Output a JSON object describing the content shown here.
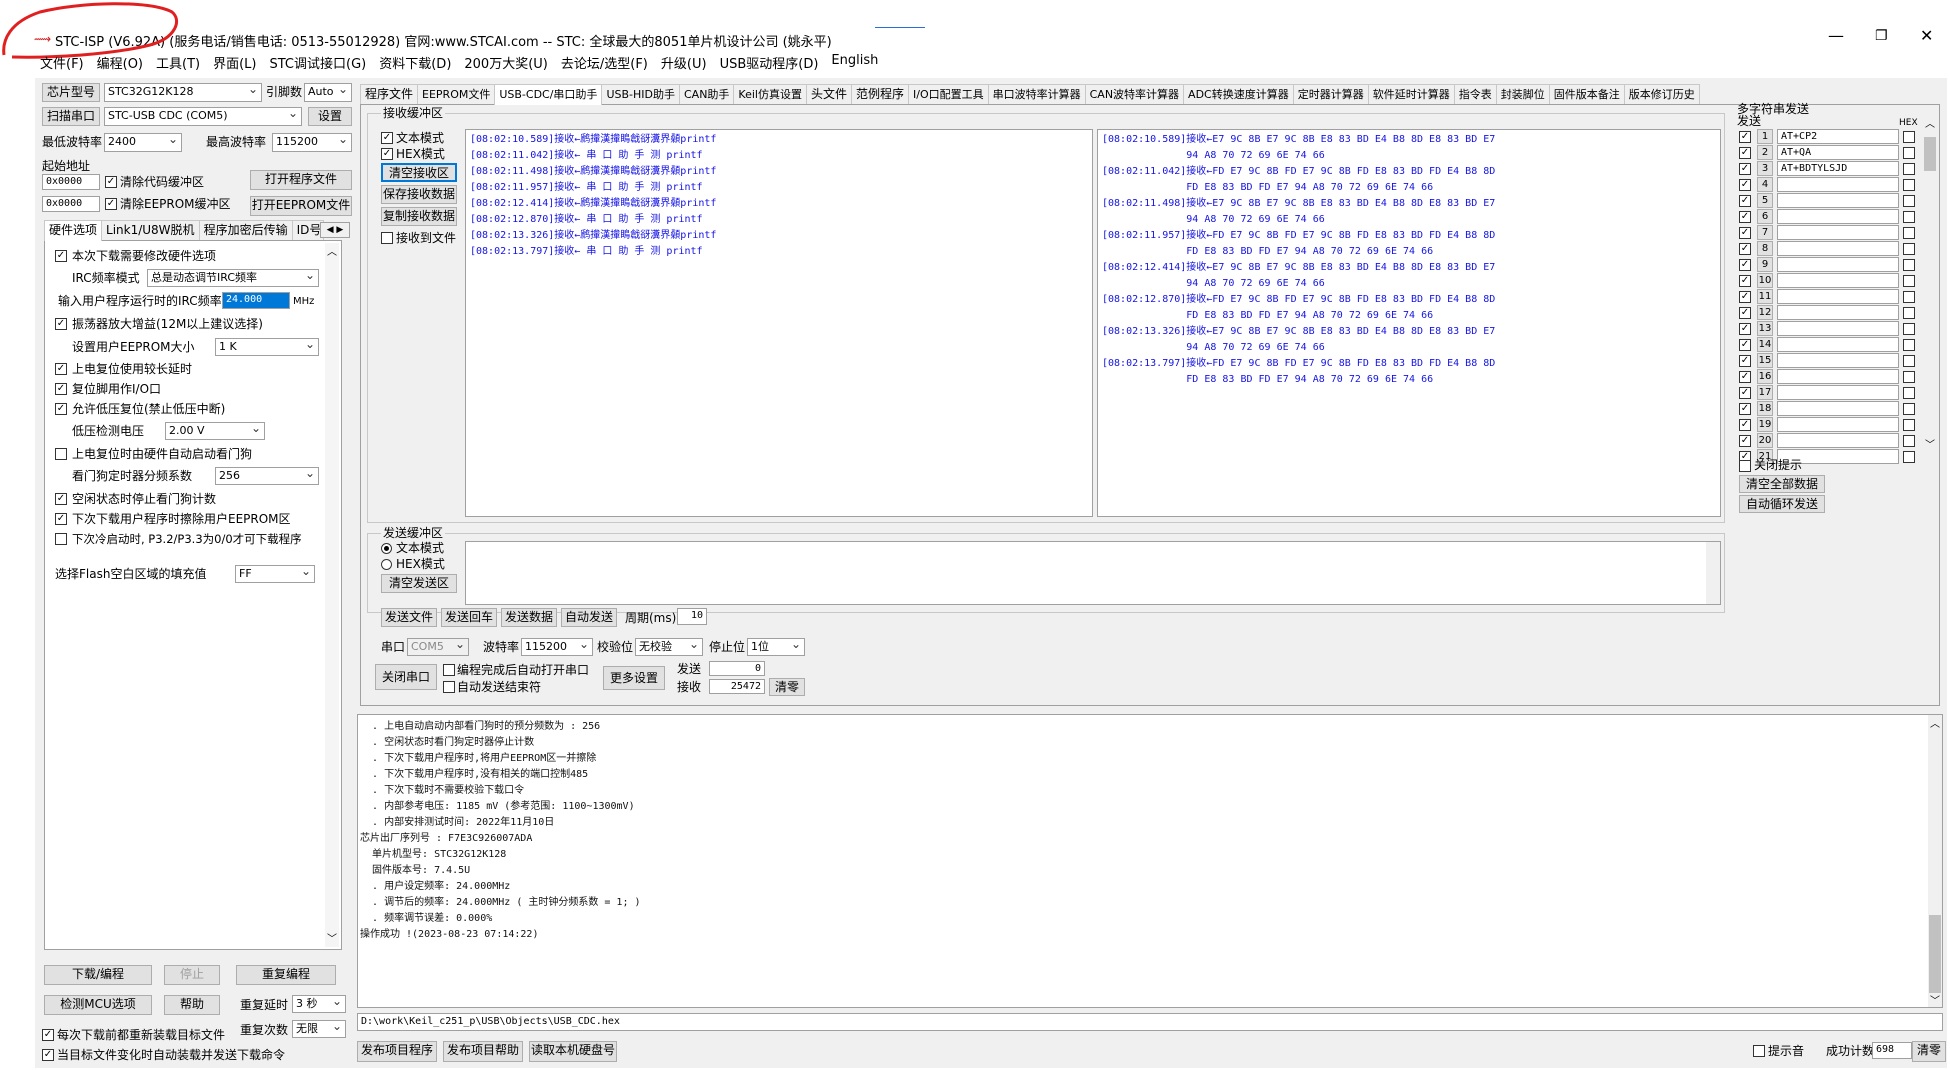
{
  "window": {
    "title": "STC-ISP (V6.92A) (服务电话/销售电话: 0513-55012928) 官网:www.STCAI.com  -- STC: 全球最大的8051单片机设计公司 (姚永平)",
    "annotation_color": "#e02020"
  },
  "menu": [
    "文件(F)",
    "编程(O)",
    "工具(T)",
    "界面(L)",
    "STC调试接口(G)",
    "资料下载(D)",
    "200万大奖(U)",
    "去论坛/选型(F)",
    "升级(U)",
    "USB驱动程序(D)",
    "English"
  ],
  "left": {
    "chip_type_btn": "芯片型号",
    "chip_type": "STC32G12K128",
    "pins_label": "引脚数",
    "pins": "Auto",
    "scan_port_btn": "扫描串口",
    "port": "STC-USB CDC (COM5)",
    "settings_btn": "设置",
    "min_baud_label": "最低波特率",
    "min_baud": "2400",
    "max_baud_label": "最高波特率",
    "max_baud": "115200",
    "start_addr_label": "起始地址",
    "addr1": "0x0000",
    "clear_code_label": "清除代码缓冲区",
    "open_program_btn": "打开程序文件",
    "addr2": "0x0000",
    "clear_eeprom_label": "清除EEPROM缓冲区",
    "open_eeprom_btn": "打开EEPROM文件",
    "tabs": [
      "硬件选项",
      "Link1/U8W脱机",
      "程序加密后传输",
      "ID号"
    ],
    "options": [
      {
        "text": "本次下载需要修改硬件选项",
        "checked": true
      },
      {
        "text": "IRC频率模式",
        "select": "总是动态调节IRC频率"
      },
      {
        "text": "输入用户程序运行时的IRC频率",
        "input": "24.000",
        "unit": "MHz"
      },
      {
        "text": "振荡器放大增益(12M以上建议选择)",
        "checked": true
      },
      {
        "text": "设置用户EEPROM大小",
        "select": "1   K"
      },
      {
        "text": "上电复位使用较长延时",
        "checked": true
      },
      {
        "text": "复位脚用作I/O口",
        "checked": true
      },
      {
        "text": "允许低压复位(禁止低压中断)",
        "checked": true
      },
      {
        "text": "低压检测电压",
        "select": "2.00 V"
      },
      {
        "text": "上电复位时由硬件自动启动看门狗",
        "checked": false
      },
      {
        "text": "看门狗定时器分频系数",
        "select": "256"
      },
      {
        "text": "空闲状态时停止看门狗计数",
        "checked": true
      },
      {
        "text": "下次下载用户程序时擦除用户EEPROM区",
        "checked": true
      },
      {
        "text": "下次冷启动时, P3.2/P3.3为0/0才可下载程序",
        "checked": false
      },
      {
        "text": "选择Flash空白区域的填充值",
        "select": "FF"
      }
    ],
    "download_btn": "下载/编程",
    "stop_btn": "停止",
    "reprogram_btn": "重复编程",
    "detect_btn": "检测MCU选项",
    "help_btn": "帮助",
    "repeat_delay_label": "重复延时",
    "repeat_delay": "3 秒",
    "repeat_count_label": "重复次数",
    "repeat_count": "无限",
    "reload_before_label": "每次下载前都重新装载目标文件",
    "auto_load_label": "当目标文件变化时自动装载并发送下载命令"
  },
  "tabs": [
    "程序文件",
    "EEPROM文件",
    "USB-CDC/串口助手",
    "USB-HID助手",
    "CAN助手",
    "Keil仿真设置",
    "头文件",
    "范例程序",
    "I/O口配置工具",
    "串口波特率计算器",
    "CAN波特率计算器",
    "ADC转换速度计算器",
    "定时器计算器",
    "软件延时计算器",
    "指令表",
    "封装脚位",
    "固件版本备注",
    "版本修订历史"
  ],
  "receive": {
    "group_label": "接收缓冲区",
    "text_mode": "文本模式",
    "hex_mode": "HEX模式",
    "clear_btn": "清空接收区",
    "save_btn": "保存接收数据",
    "copy_btn": "复制接收数据",
    "to_file": "接收到文件",
    "text_lines": [
      "[08:02:10.589]接收←䴘撪漢撪瞗戧谺瀵界顙printf",
      "[08:02:11.042]接收← 串 口 助 手 测 printf",
      "[08:02:11.498]接收←䴘撪漢撪瞗戧谺瀵界顙printf",
      "[08:02:11.957]接收← 串 口 助 手 测 printf",
      "[08:02:12.414]接收←䴘撪漢撪瞗戧谺瀵界顙printf",
      "[08:02:12.870]接收← 串 口 助 手 测 printf",
      "[08:02:13.326]接收←䴘撪漢撪瞗戧谺瀵界顙printf",
      "[08:02:13.797]接收← 串 口 助 手 测 printf"
    ],
    "hex_lines": [
      "[08:02:10.589]接收←E7 9C 8B E7 9C 8B E8 83 BD E4 B8 8D E8 83 BD E7",
      "              94 A8 70 72 69 6E 74 66",
      "[08:02:11.042]接收←FD E7 9C 8B FD E7 9C 8B FD E8 83 BD FD E4 B8 8D",
      "              FD E8 83 BD FD E7 94 A8 70 72 69 6E 74 66",
      "[08:02:11.498]接收←E7 9C 8B E7 9C 8B E8 83 BD E4 B8 8D E8 83 BD E7",
      "              94 A8 70 72 69 6E 74 66",
      "[08:02:11.957]接收←FD E7 9C 8B FD E7 9C 8B FD E8 83 BD FD E4 B8 8D",
      "              FD E8 83 BD FD E7 94 A8 70 72 69 6E 74 66",
      "[08:02:12.414]接收←E7 9C 8B E7 9C 8B E8 83 BD E4 B8 8D E8 83 BD E7",
      "              94 A8 70 72 69 6E 74 66",
      "[08:02:12.870]接收←FD E7 9C 8B FD E7 9C 8B FD E8 83 BD FD E4 B8 8D",
      "              FD E8 83 BD FD E7 94 A8 70 72 69 6E 74 66",
      "[08:02:13.326]接收←E7 9C 8B E7 9C 8B E8 83 BD E4 B8 8D E8 83 BD E7",
      "              94 A8 70 72 69 6E 74 66",
      "[08:02:13.797]接收←FD E7 9C 8B FD E7 9C 8B FD E8 83 BD FD E4 B8 8D",
      "              FD E8 83 BD FD E7 94 A8 70 72 69 6E 74 66"
    ]
  },
  "send": {
    "group_label": "发送缓冲区",
    "text_mode": "文本模式",
    "hex_mode": "HEX模式",
    "clear_btn": "清空发送区",
    "send_file_btn": "发送文件",
    "send_enter_btn": "发送回车",
    "send_data_btn": "发送数据",
    "auto_send_btn": "自动发送",
    "period_label": "周期(ms)",
    "period": "10"
  },
  "port": {
    "port_label": "串口",
    "port": "COM5",
    "baud_label": "波特率",
    "baud": "115200",
    "parity_label": "校验位",
    "parity": "无校验",
    "stop_label": "停止位",
    "stop": "1位",
    "close_btn": "关闭串口",
    "auto_open_label": "编程完成后自动打开串口",
    "auto_end_label": "自动发送结束符",
    "more_btn": "更多设置",
    "sent_label": "发送",
    "sent": "0",
    "recv_label": "接收",
    "recv": "25472",
    "clear_btn": "清零"
  },
  "multi": {
    "title": "多字符串发送",
    "send_header": "发送",
    "hex_header": "HEX",
    "rows": [
      {
        "n": "1",
        "v": "AT+CP2"
      },
      {
        "n": "2",
        "v": "AT+QA"
      },
      {
        "n": "3",
        "v": "AT+BDTYLSJD"
      },
      {
        "n": "4",
        "v": ""
      },
      {
        "n": "5",
        "v": ""
      },
      {
        "n": "6",
        "v": ""
      },
      {
        "n": "7",
        "v": ""
      },
      {
        "n": "8",
        "v": ""
      },
      {
        "n": "9",
        "v": ""
      },
      {
        "n": "10",
        "v": ""
      },
      {
        "n": "11",
        "v": ""
      },
      {
        "n": "12",
        "v": ""
      },
      {
        "n": "13",
        "v": ""
      },
      {
        "n": "14",
        "v": ""
      },
      {
        "n": "15",
        "v": ""
      },
      {
        "n": "16",
        "v": ""
      },
      {
        "n": "17",
        "v": ""
      },
      {
        "n": "18",
        "v": ""
      },
      {
        "n": "19",
        "v": ""
      },
      {
        "n": "20",
        "v": ""
      },
      {
        "n": "21",
        "v": ""
      }
    ],
    "close_tip": "关闭提示",
    "clear_all_btn": "清空全部数据",
    "auto_loop_btn": "自动循环发送"
  },
  "log": {
    "lines": [
      "  . 上电自动启动内部看门狗时的预分频数为 : 256",
      "  . 空闲状态时看门狗定时器停止计数",
      "  . 下次下载用户程序时,将用户EEPROM区一并擦除",
      "  . 下次下载用户程序时,没有相关的端口控制485",
      "  . 下次下载时不需要校验下载口令",
      "  . 内部参考电压: 1185 mV (参考范围: 1100~1300mV)",
      "  . 内部安排测试时间: 2022年11月10日",
      "芯片出厂序列号 : F7E3C926007ADA",
      "",
      "  单片机型号: STC32G12K128",
      "  固件版本号: 7.4.5U",
      "",
      "  . 用户设定频率: 24.000MHz",
      "  . 调节后的频率: 24.000MHz ( 主时钟分频系数 = 1; )",
      "  . 频率调节误差: 0.000%",
      "",
      "操作成功 !(2023-08-23 07:14:22)"
    ],
    "file_path": "D:\\work\\Keil_c251_p\\USB\\Objects\\USB_CDC.hex"
  },
  "bottom": {
    "publish_btn": "发布项目程序",
    "publish_help_btn": "发布项目帮助",
    "read_disk_btn": "读取本机硬盘号",
    "tip_label": "提示音",
    "success_label": "成功计数",
    "success": "698",
    "clear_btn": "清零"
  }
}
